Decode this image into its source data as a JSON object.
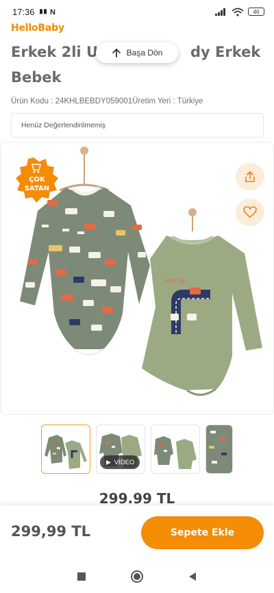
{
  "status_bar": {
    "time": "17:36",
    "battery": "46"
  },
  "brand": "HelloBaby",
  "product": {
    "title": "Erkek 2li Uzun Kollu Body Erkek Bebek",
    "title_visible_line1": "Erkek 2li Uz",
    "title_visible_line1b": "dy Erkek",
    "title_visible_line2": "Bebek",
    "code_line": "Ürün Kodu : 24KHLBEBDY059001Üretim Yeri : Türkiye",
    "reviews": "Henüz Değerlendirilmemiş",
    "price_mid": "299.99 TL",
    "price": "299,99 TL"
  },
  "back_to_top": {
    "label": "Başa Dön",
    "icon": "arrow-up-icon"
  },
  "gallery": {
    "badge_line1": "ÇOK",
    "badge_line2": "SATAN",
    "print_text": "let's go",
    "share_icon": "share-icon",
    "favorite_icon": "heart-icon"
  },
  "thumbnails": [
    {
      "label": ""
    },
    {
      "label": "VİDEO"
    },
    {
      "label": ""
    },
    {
      "label": ""
    }
  ],
  "actions": {
    "add_to_cart": "Sepete Ekle"
  },
  "colors": {
    "accent": "#f48c06",
    "brand": "#f08c00",
    "body_gray": "#7f8b78",
    "body_green": "#9caa83"
  }
}
